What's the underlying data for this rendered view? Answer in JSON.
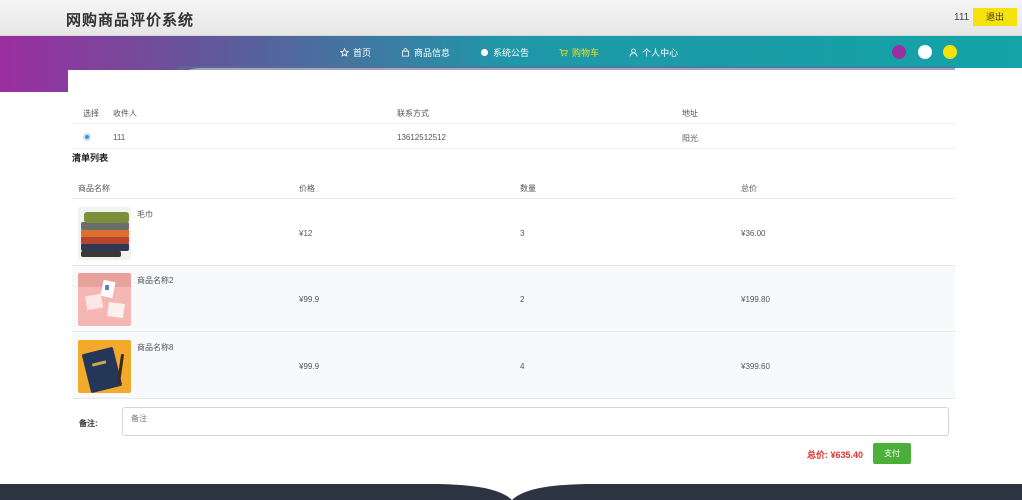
{
  "header": {
    "title": "网购商品评价系统",
    "username": "111",
    "logout_label": "退出"
  },
  "nav": {
    "items": [
      {
        "label": "首页",
        "icon": "star-icon"
      },
      {
        "label": "商品信息",
        "icon": "bag-icon"
      },
      {
        "label": "系统公告",
        "icon": "circle-icon"
      },
      {
        "label": "购物车",
        "icon": "cart-icon",
        "active": true
      },
      {
        "label": "个人中心",
        "icon": "user-icon"
      }
    ],
    "theme_dots": [
      "#9b2f9f",
      "#ffffff",
      "#f5e10b"
    ]
  },
  "address": {
    "headers": {
      "select": "选择",
      "receiver": "收件人",
      "contact": "联系方式",
      "address": "地址"
    },
    "rows": [
      {
        "receiver": "111",
        "contact": "13612512512",
        "address": "阳光"
      }
    ]
  },
  "order_list": {
    "title": "清单列表",
    "headers": {
      "name": "商品名称",
      "price": "价格",
      "quantity": "数量",
      "total": "总价"
    },
    "items": [
      {
        "name": "毛巾",
        "price": "¥12",
        "quantity": "3",
        "total": "¥36.00",
        "image": "towel-image"
      },
      {
        "name": "商品名称2",
        "price": "¥99.9",
        "quantity": "2",
        "total": "¥199.80",
        "image": "pink-notes-image"
      },
      {
        "name": "商品名称8",
        "price": "¥99.9",
        "quantity": "4",
        "total": "¥399.60",
        "image": "notebook-image"
      }
    ]
  },
  "note": {
    "label": "备注:",
    "placeholder": "备注"
  },
  "summary": {
    "total_text": "总价: ¥635.40",
    "pay_label": "支付"
  },
  "colors": {
    "accent_yellow": "#f5e10b",
    "band_purple": "#9b2f9f",
    "band_teal": "#13a3a8",
    "pay_green": "#4caf3a",
    "total_red": "#e0332a"
  }
}
